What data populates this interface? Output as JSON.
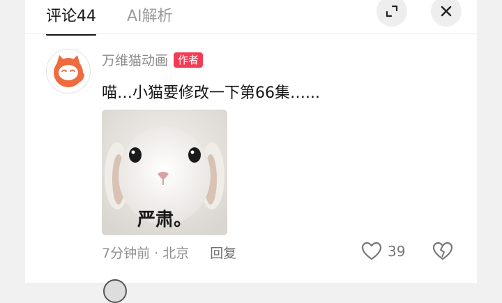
{
  "tabs": [
    {
      "label": "评论44",
      "active": true
    },
    {
      "label": "AI解析",
      "active": false
    }
  ],
  "header": {
    "expand_icon": "expand-icon",
    "close_icon": "close-icon"
  },
  "comment": {
    "author": "万维猫动画",
    "author_badge": "作者",
    "text": "喵…小猫要修改一下第66集…...",
    "sticker_caption": "严肃。",
    "time_location": "7分钟前 · 北京",
    "reply_label": "回复",
    "likes": "39"
  },
  "colors": {
    "badge": "#f43b55",
    "avatar_accent": "#ef6a3c",
    "active_tab": "#161616",
    "inactive_tab": "#9b9b9b"
  }
}
